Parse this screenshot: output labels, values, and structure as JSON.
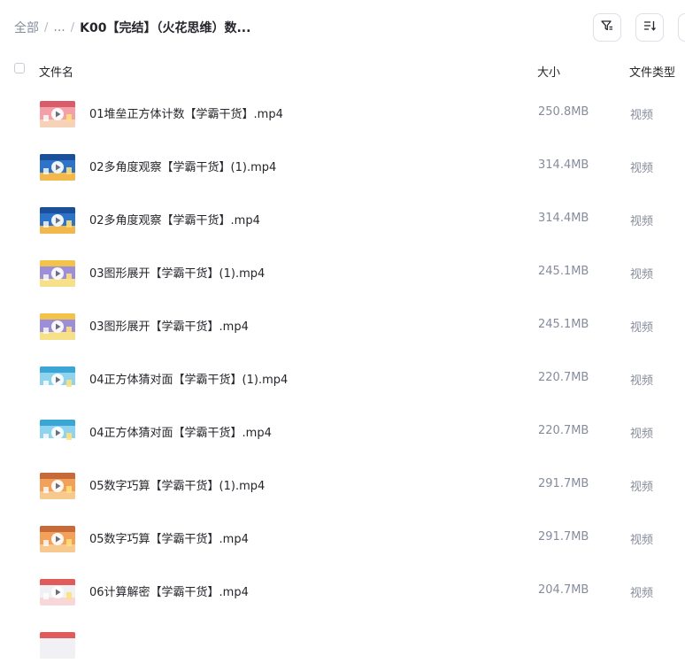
{
  "breadcrumb": {
    "root": "全部",
    "ellipsis": "...",
    "current": "K00【完结】（火花思维）数..."
  },
  "toolbar": {
    "filter_icon": "filter-icon",
    "sort_icon": "sort-icon"
  },
  "table": {
    "columns": {
      "name": "文件名",
      "size": "大小",
      "type": "文件类型"
    },
    "rows": [
      {
        "name": "01堆垒正方体计数【学霸干货】.mp4",
        "size": "250.8MB",
        "type": "视频",
        "thumb": "pink"
      },
      {
        "name": "02多角度观察【学霸干货】(1).mp4",
        "size": "314.4MB",
        "type": "视频",
        "thumb": "blue"
      },
      {
        "name": "02多角度观察【学霸干货】.mp4",
        "size": "314.4MB",
        "type": "视频",
        "thumb": "blue"
      },
      {
        "name": "03图形展开【学霸干货】(1).mp4",
        "size": "245.1MB",
        "type": "视频",
        "thumb": "purple"
      },
      {
        "name": "03图形展开【学霸干货】.mp4",
        "size": "245.1MB",
        "type": "视频",
        "thumb": "purple"
      },
      {
        "name": "04正方体猜对面【学霸干货】(1).mp4",
        "size": "220.7MB",
        "type": "视频",
        "thumb": "sky"
      },
      {
        "name": "04正方体猜对面【学霸干货】.mp4",
        "size": "220.7MB",
        "type": "视频",
        "thumb": "sky"
      },
      {
        "name": "05数字巧算【学霸干货】(1).mp4",
        "size": "291.7MB",
        "type": "视频",
        "thumb": "orange"
      },
      {
        "name": "05数字巧算【学霸干货】.mp4",
        "size": "291.7MB",
        "type": "视频",
        "thumb": "orange"
      },
      {
        "name": "06计算解密【学霸干货】.mp4",
        "size": "204.7MB",
        "type": "视频",
        "thumb": "white"
      }
    ]
  },
  "colors": {
    "text": "#25262b",
    "muted": "#878c9c",
    "border": "#dcdfe6"
  }
}
